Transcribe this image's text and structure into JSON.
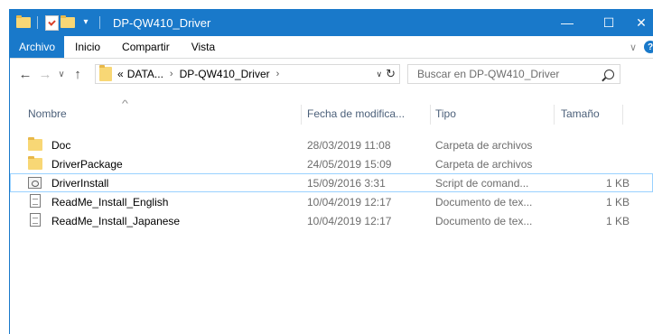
{
  "window": {
    "title": "DP-QW410_Driver",
    "controls": {
      "minimize": "—",
      "maximize": "☐",
      "close": "✕"
    }
  },
  "ribbon": {
    "tabs": [
      {
        "label": "Archivo"
      },
      {
        "label": "Inicio"
      },
      {
        "label": "Compartir"
      },
      {
        "label": "Vista"
      }
    ],
    "help_label": "?"
  },
  "address": {
    "overflow": "«",
    "crumbs": [
      "DATA...",
      "DP-QW410_Driver"
    ]
  },
  "search": {
    "placeholder": "Buscar en DP-QW410_Driver"
  },
  "columns": {
    "name": "Nombre",
    "date": "Fecha de modifica...",
    "type": "Tipo",
    "size": "Tamaño"
  },
  "files": [
    {
      "name": "Doc",
      "icon": "folder-icon",
      "date": "28/03/2019 11:08",
      "type": "Carpeta de archivos",
      "size": ""
    },
    {
      "name": "DriverPackage",
      "icon": "folder-icon",
      "date": "24/05/2019 15:09",
      "type": "Carpeta de archivos",
      "size": ""
    },
    {
      "name": "DriverInstall",
      "icon": "script-file-icon",
      "date": "15/09/2016 3:31",
      "type": "Script de comand...",
      "size": "1 KB",
      "selected": true
    },
    {
      "name": "ReadMe_Install_English",
      "icon": "text-document-icon",
      "date": "10/04/2019 12:17",
      "type": "Documento de tex...",
      "size": "1 KB"
    },
    {
      "name": "ReadMe_Install_Japanese",
      "icon": "text-document-icon",
      "date": "10/04/2019 12:17",
      "type": "Documento de tex...",
      "size": "1 KB"
    }
  ],
  "colors": {
    "accent": "#1979ca",
    "selection_border": "#99d1ff",
    "header_text": "#4c607a",
    "meta_text": "#6d6d6d"
  }
}
